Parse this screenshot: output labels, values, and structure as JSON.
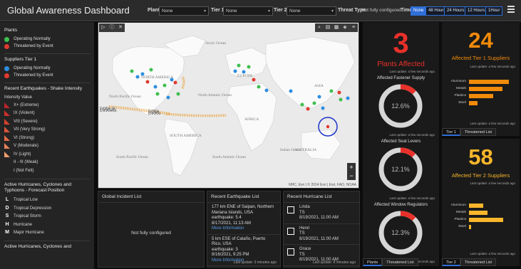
{
  "header": {
    "title": "Global Awareness Dashboard",
    "plant_label": "Plant",
    "plant_value": "None",
    "tier1_label": "Tier 1",
    "tier1_value": "None",
    "tier2_label": "Tier 2",
    "tier2_value": "None",
    "threat_label": "Threat Type",
    "threat_value": "Not fully configured",
    "time_label": "Time",
    "time_options": [
      "None",
      "48 Hours",
      "24 Hours",
      "12 Hours",
      "1Hour"
    ],
    "time_selected": "None"
  },
  "legend": {
    "plants_heading": "Plants",
    "plants": [
      {
        "label": "Operating Normally",
        "color": "#3fbf4f"
      },
      {
        "label": "Threatened by Event",
        "color": "#e03a2f"
      }
    ],
    "suppliers_heading": "Suppliers Tier 1",
    "suppliers": [
      {
        "label": "Operating Normally",
        "color": "#2d8ee0"
      },
      {
        "label": "Threatened by Event",
        "color": "#e03a2f"
      }
    ],
    "eq_heading": "Recent Earthquakes - Shake Intensity",
    "intensity_heading": "Intensity Value",
    "intensities": [
      {
        "label": "X+ (Extreme)",
        "color": "#b8252a"
      },
      {
        "label": "IX (Violent)",
        "color": "#c9302b"
      },
      {
        "label": "VIII (Severe)",
        "color": "#d2402e"
      },
      {
        "label": "VII (Very Strong)",
        "color": "#d9543a"
      },
      {
        "label": "VI (Strong)",
        "color": "#e06a48"
      },
      {
        "label": "V (Moderate)",
        "color": "#e58258"
      },
      {
        "label": "IV (Light)",
        "color": "#eb9a6c"
      },
      {
        "label": "II - III (Weak)",
        "color": ""
      },
      {
        "label": "I (Not Felt)",
        "color": ""
      }
    ],
    "hurr_heading": "Active Hurricanes, Cyclones and Typhoons - Forecast Position",
    "hurr_items": [
      {
        "symbol": "L",
        "label": "Tropical Low"
      },
      {
        "symbol": "D",
        "label": "Tropical Depression"
      },
      {
        "symbol": "S",
        "label": "Tropical Storm"
      },
      {
        "symbol": "H",
        "label": "Hurricane"
      },
      {
        "symbol": "M",
        "label": "Major Hurricane"
      }
    ],
    "hurr_heading2": "Active Hurricanes, Cyclones and"
  },
  "map": {
    "labels": {
      "north_america": "NORTH AMERICA",
      "south_america": "SOUTH AMERICA",
      "europe": "EUROPE",
      "africa": "AFRICA",
      "asia": "ASIA",
      "australia": "AUSTRALIA",
      "arctic": "Arctic Ocean",
      "north_atlantic": "North Atlantic Ocean",
      "south_atlantic": "South Atlantic Ocean",
      "north_pacific": "North Pacific Ocean",
      "south_pacific": "South Pacific Ocean",
      "indian": "Indian Ocean",
      "dns1": "DNS.S.",
      "dns2": "DNS."
    },
    "attribution": "NHC, Esri | © 2014 Esri | Esri, FAO, NOAA"
  },
  "incidents": {
    "title": "Global Incident List",
    "empty_text": "Not fully configured"
  },
  "earthquakes": {
    "title": "Recent Earthquake List",
    "items": [
      {
        "line1": "177 km ENE of Saipan, Northern Mariana Islands, USA",
        "line2": "earthquake: 5.4",
        "line3": "8/17/2021, 11:13 AM",
        "more": "More Information"
      },
      {
        "line1": "5 km ESE of Cataño, Puerto Rico, USA",
        "line2": "earthquake: 3",
        "line3": "8/16/2021, 9:25 PM",
        "more": "More Information"
      }
    ],
    "update": "Last update: 3 minutes ago"
  },
  "hurricanes": {
    "title": "Recent Hurricane List",
    "items": [
      {
        "name": "Linda",
        "type": "TS",
        "date": "8/19/2021, 11:00 AM"
      },
      {
        "name": "Henri",
        "type": "TS",
        "date": "8/19/2021, 11:00 AM"
      },
      {
        "name": "Grace",
        "type": "TS",
        "date": "8/19/2021, 11:00 AM"
      }
    ],
    "update": "Last update: 8 minutes ago"
  },
  "plants_col": {
    "count": "3",
    "label": "Plants Affected",
    "update": "Last update: a few seconds ago",
    "gauges": [
      {
        "title": "Affected Fastener Supply",
        "value": "12.6%",
        "fraction": 0.126,
        "update": "Last update: a few seconds ago"
      },
      {
        "title": "Affected Seat Levers",
        "value": "12.1%",
        "fraction": 0.121,
        "update": "Last update: a few seconds ago"
      },
      {
        "title": "Affected Window Regulators",
        "value": "12.3%",
        "fraction": 0.123,
        "update": "Last update: a few seconds ago"
      }
    ],
    "tabs": [
      "Plants",
      "Threatened List"
    ]
  },
  "tier1_col": {
    "count": "24",
    "label": "Affected Tier 1 Suppliers",
    "update": "Last update: a few seconds ago",
    "bars": [
      {
        "label": "Aluminum",
        "value": 0.9
      },
      {
        "label": "Metals",
        "value": 0.75
      },
      {
        "label": "Plastics",
        "value": 0.55
      },
      {
        "label": "Steel",
        "value": 0.2
      }
    ],
    "tabs": [
      "Tier 1",
      "Threatened List"
    ]
  },
  "tier2_col": {
    "count": "58",
    "label": "Affected Tier 2 Suppliers",
    "update": "Last update: a few seconds ago",
    "bars": [
      {
        "label": "Aluminum",
        "value": 0.32
      },
      {
        "label": "Metals",
        "value": 0.42
      },
      {
        "label": "Plastics",
        "value": 0.78
      },
      {
        "label": "Steel",
        "value": 0.05
      }
    ],
    "tabs": [
      "Tier 2",
      "Threatened List"
    ]
  },
  "colors": {
    "accent": "#2f6fd8",
    "red": "#e8312a",
    "orange": "#f28a0a"
  }
}
